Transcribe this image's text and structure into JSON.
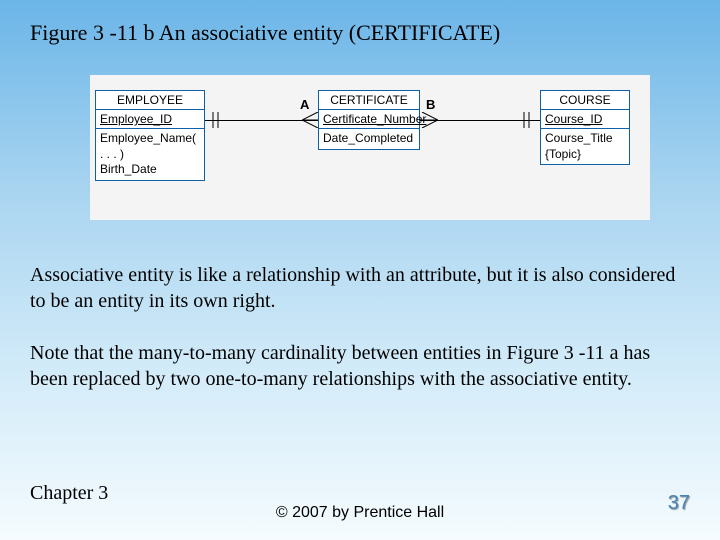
{
  "title": "Figure 3 -11 b An associative entity (CERTIFICATE)",
  "diagram": {
    "relA": "A",
    "relB": "B",
    "employee": {
      "name": "EMPLOYEE",
      "key": "Employee_ID",
      "attr1": "Employee_Name( . . . )",
      "attr2": "Birth_Date"
    },
    "certificate": {
      "name": "CERTIFICATE",
      "key": "Certificate_Number",
      "attr1": "Date_Completed"
    },
    "course": {
      "name": "COURSE",
      "key": "Course_ID",
      "attr1": "Course_Title",
      "attr2": "{Topic}"
    }
  },
  "para1": "Associative entity is like a relationship with an attribute, but it is also considered to be an entity in its own right.",
  "para2": "Note that the many-to-many cardinality between entities in Figure 3 -11 a has been replaced by two one-to-many relationships with the associative entity.",
  "footer": {
    "chapter": "Chapter 3",
    "copyright": "© 2007 by Prentice Hall",
    "page": "37"
  }
}
